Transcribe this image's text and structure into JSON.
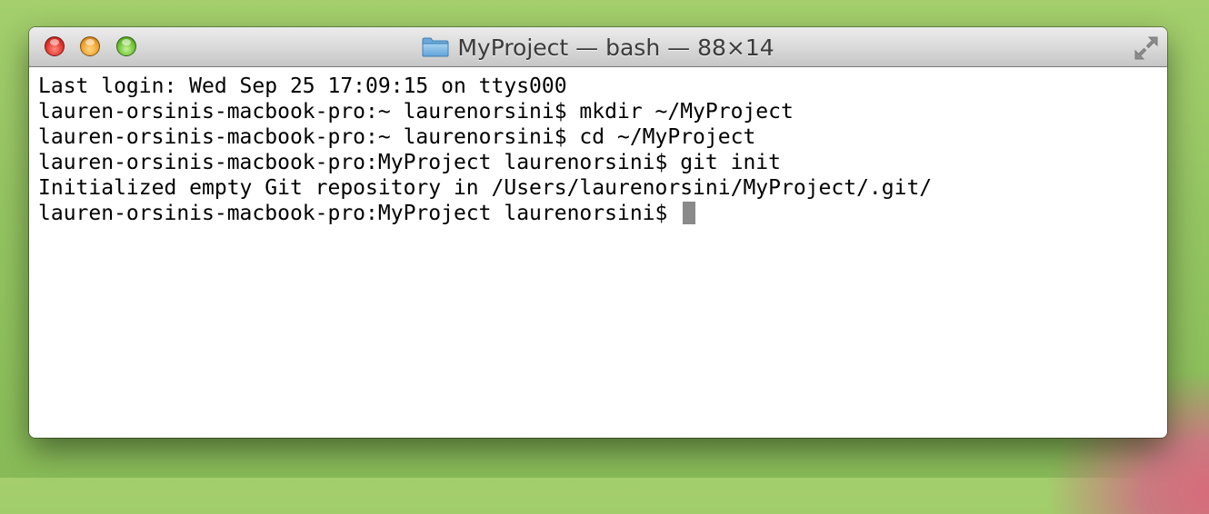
{
  "window": {
    "title": "MyProject — bash — 88×14"
  },
  "titlebar": {
    "buttons": [
      "close",
      "minimize",
      "zoom"
    ],
    "folder_icon": "folder-icon",
    "fullscreen_icon": "fullscreen-icon"
  },
  "terminal": {
    "lines": [
      "Last login: Wed Sep 25 17:09:15 on ttys000",
      "lauren-orsinis-macbook-pro:~ laurenorsini$ mkdir ~/MyProject",
      "lauren-orsinis-macbook-pro:~ laurenorsini$ cd ~/MyProject",
      "lauren-orsinis-macbook-pro:MyProject laurenorsini$ git init",
      "Initialized empty Git repository in /Users/laurenorsini/MyProject/.git/"
    ],
    "prompt": "lauren-orsinis-macbook-pro:MyProject laurenorsini$ "
  },
  "colors": {
    "close": "#e2332b",
    "minimize": "#f0a22a",
    "zoom": "#6ec233",
    "cursor": "#8a8a8a",
    "desktop": "#94c462"
  }
}
